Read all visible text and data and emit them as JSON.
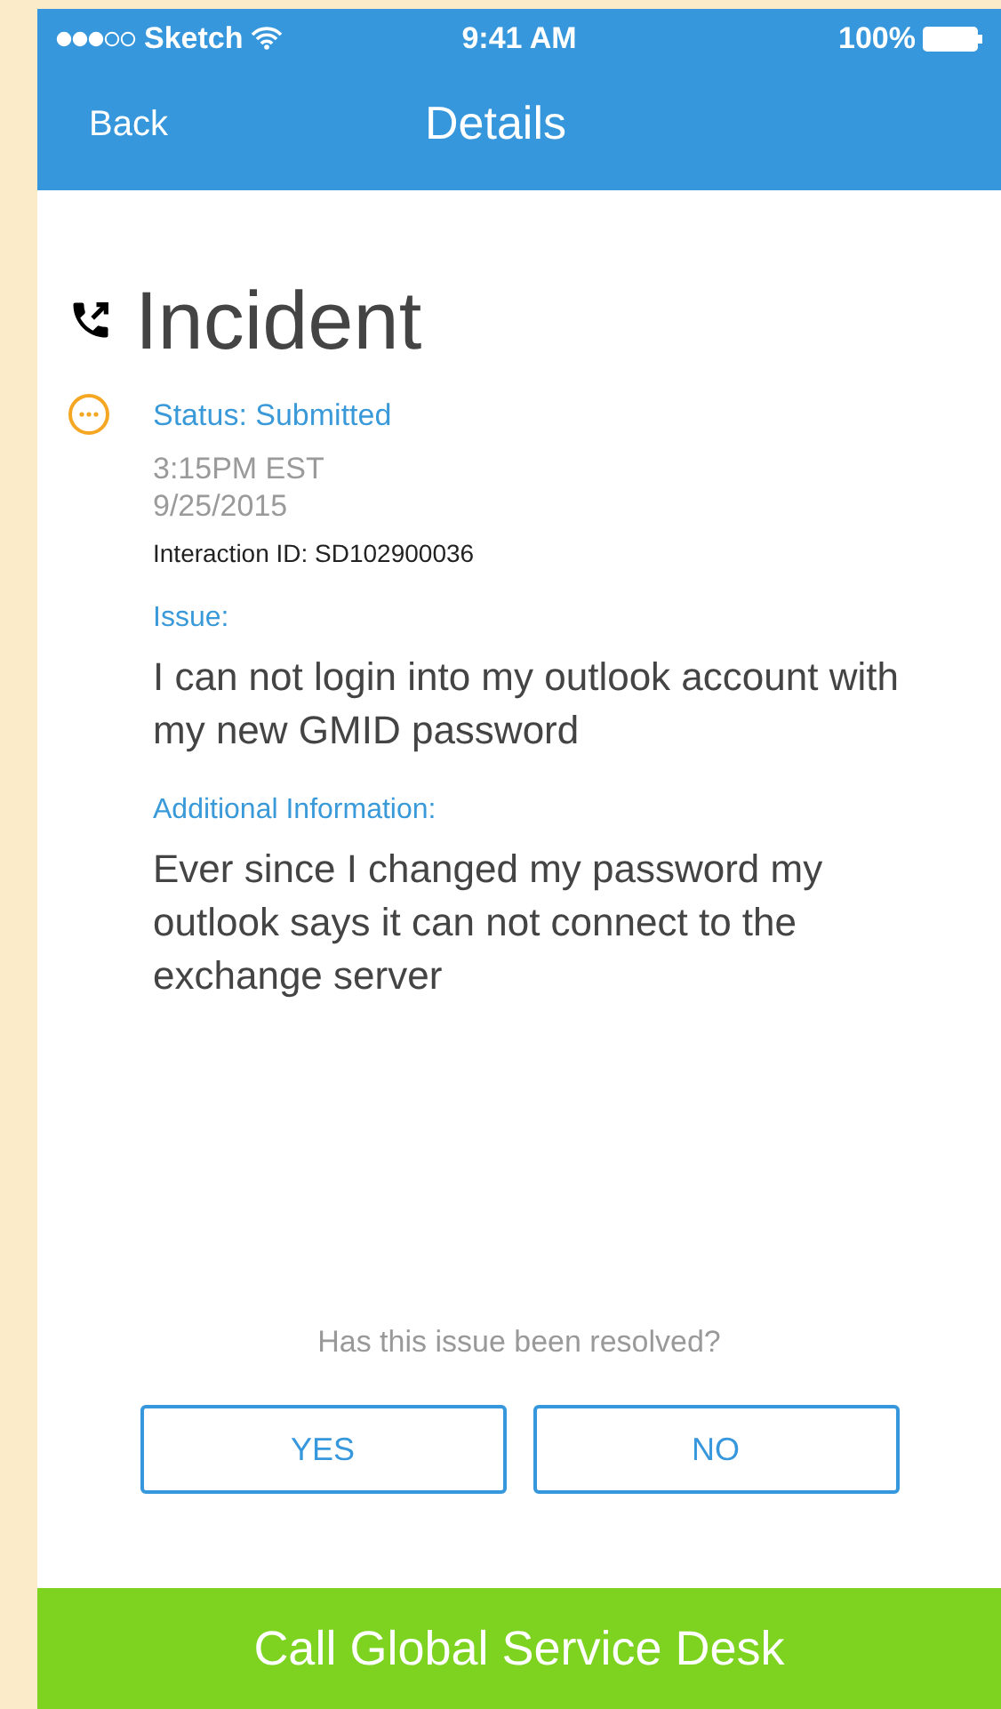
{
  "status_bar": {
    "carrier": "Sketch",
    "time": "9:41 AM",
    "battery": "100%"
  },
  "nav_bar": {
    "back": "Back",
    "title": "Details"
  },
  "ticket": {
    "type": "Incident",
    "status": "Status: Submitted",
    "time": "3:15PM EST",
    "date": "9/25/2015",
    "interaction_id": "Interaction ID: SD102900036"
  },
  "sections": [
    {
      "label": "Issue:",
      "text": "I can not login into my outlook account with my new GMID password"
    },
    {
      "label": "Additional Information:",
      "text": "Ever since I changed my password my outlook says it can not connect to the exchange server"
    }
  ],
  "question": "Has this issue been resolved?",
  "answers": [
    "YES",
    "NO"
  ],
  "call_button": "Call Global Service Desk"
}
